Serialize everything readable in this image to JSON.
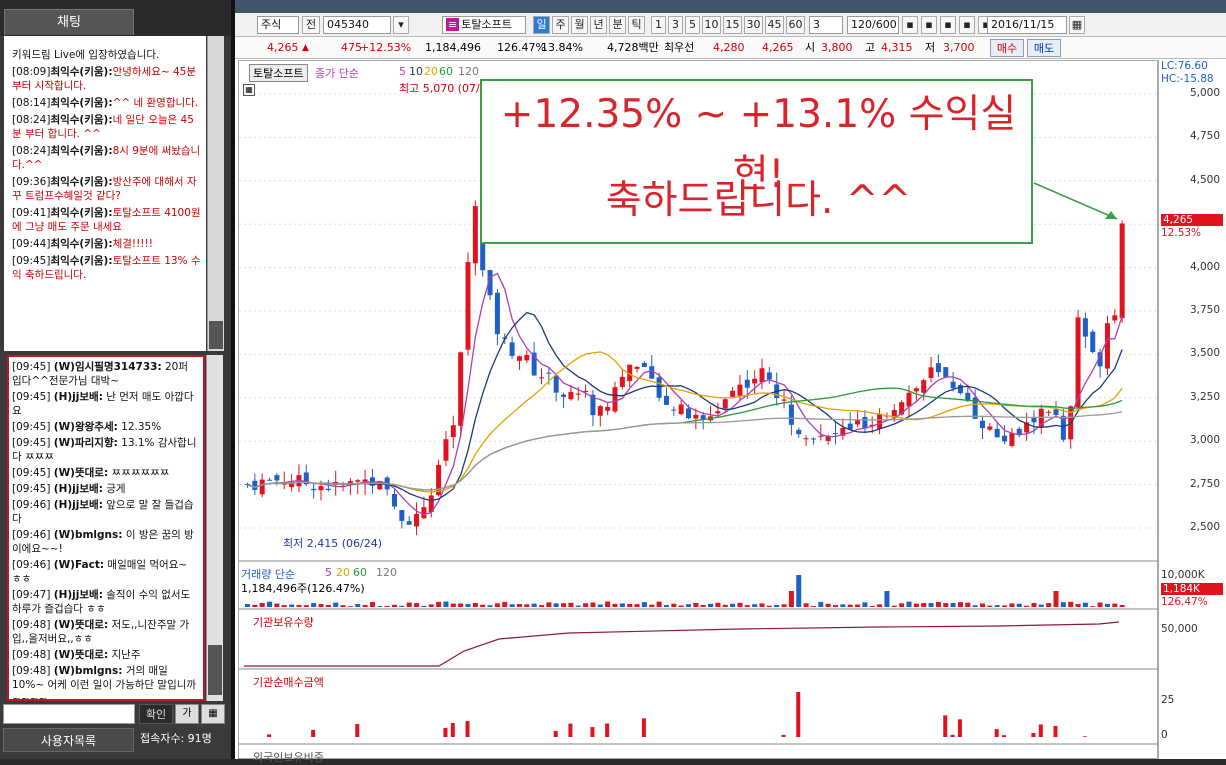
{
  "chat": {
    "tab": "채팅",
    "messages": [
      {
        "time": "",
        "name": "",
        "text": "키워드림 Live에 입장하였습니다."
      },
      {
        "time": "[08:09]",
        "name": "최익수(키움):",
        "text": "안녕하세요~ 45분부터 시작합니다."
      },
      {
        "time": "[08:14]",
        "name": "최익수(키움):",
        "text": "^^ 네 환영합니다."
      },
      {
        "time": "[08:24]",
        "name": "최익수(키움):",
        "text": "네 일단 오늘은 45분 부터 합니다. ^^"
      },
      {
        "time": "[08:24]",
        "name": "최익수(키움):",
        "text": "8시 9분에 써놨습니다.^^"
      },
      {
        "time": "[09:36]",
        "name": "최익수(키움):",
        "text": "방산주에 대해서 자꾸 트럼프수혜일것 같다?"
      },
      {
        "time": "[09:41]",
        "name": "최익수(키움):",
        "text": "토탈소프트 4100원에 그냥 매도 주문 내세요"
      },
      {
        "time": "[09:44]",
        "name": "최익수(키움):",
        "text": "체결!!!!!"
      },
      {
        "time": "[09:45]",
        "name": "최익수(키움):",
        "text": "토탈소프트 13% 수익 축하드립니다."
      }
    ],
    "public": [
      {
        "time": "[09:45]",
        "name": "(W)임시필명314733:",
        "text": "20퍼 입다^^전문가님 대박~"
      },
      {
        "time": "[09:45]",
        "name": "(H)jj보배:",
        "text": "난 먼저 매도 아깝다요"
      },
      {
        "time": "[09:45]",
        "name": "(W)왕왕추세:",
        "text": "12.35%"
      },
      {
        "time": "[09:45]",
        "name": "(W)파리지향:",
        "text": "13.1% 감사합니다 ㅉㅉㅉ"
      },
      {
        "time": "[09:45]",
        "name": "(W)뜻대로:",
        "text": "ㅉㅉㅉㅉㅉㅉ"
      },
      {
        "time": "[09:45]",
        "name": "(H)jj보배:",
        "text": "긍게"
      },
      {
        "time": "[09:46]",
        "name": "(H)jj보배:",
        "text": "앞으로 말 잘 들겁습다"
      },
      {
        "time": "[09:46]",
        "name": "(W)bmlgns:",
        "text": "이 방은 꿈의 방이에요~~!"
      },
      {
        "time": "[09:46]",
        "name": "(W)Fact:",
        "text": "매일매일 먹어요~ ㅎㅎ"
      },
      {
        "time": "[09:47]",
        "name": "(H)jj보배:",
        "text": "솔직이 수익 없서도 하루가 즐겁습다 ㅎㅎ"
      },
      {
        "time": "[09:48]",
        "name": "(W)뜻대로:",
        "text": "저도,,니잔주말 가입,,올저버요,,ㅎㅎ"
      },
      {
        "time": "[09:48]",
        "name": "(W)뜻대로:",
        "text": "지난주"
      },
      {
        "time": "[09:48]",
        "name": "(W)bmlgns:",
        "text": "거의 매일 10%~ 어케 이런 일이 가능하단 말입니까~~~~"
      },
      {
        "time": "[09:48]",
        "name": "(W)뜻대로:",
        "text": "넵"
      }
    ],
    "confirm": "확인",
    "ga": "가",
    "userlist": "사용자목록",
    "usercount": "접속자수: 91명"
  },
  "toolbar": {
    "type": "주식",
    "prev": "전",
    "code": "045340",
    "name": "토탈소프트",
    "periods": [
      "일",
      "주",
      "월",
      "년",
      "분",
      "틱"
    ],
    "nums": [
      "1",
      "3",
      "5",
      "10",
      "15",
      "30",
      "45",
      "60"
    ],
    "sel": "3",
    "count": "120/600",
    "date": "2016/11/15"
  },
  "quote": {
    "price": "4,265",
    "change": "475",
    "rate": "+12.53%",
    "volume": "1,184,496",
    "vrate": "126.47%",
    "turn": "13.84%",
    "amount": "4,728백만",
    "pri": "최우선",
    "ask": "4,280",
    "bid": "4,265",
    "open_l": "시",
    "open": "3,800",
    "high_l": "고",
    "high": "4,315",
    "low_l": "저",
    "low": "3,700",
    "sell": "매수",
    "buy": "매도"
  },
  "chart": {
    "name": "토탈소프트",
    "ma_label": "종가 단순",
    "ma": [
      "5",
      "10",
      "20",
      "60",
      "120"
    ],
    "high_label": "최고 5,070 (07/18)",
    "low_label": "최저 2,415 (06/24)",
    "lc": "LC:76.60",
    "hc": "HC:-15.88",
    "yticks": [
      "5,000",
      "4,750",
      "4,500",
      "4,250",
      "4,000",
      "3,750",
      "3,500",
      "3,250",
      "3,000",
      "2,750",
      "2,500"
    ],
    "last": "4,265",
    "lastpct": "12.53%",
    "annot1": "+12.35% ~ +13.1% 수익실현!",
    "annot2": "축하드립니다. ^^"
  },
  "vol": {
    "label": "거래량 단순",
    "ma": [
      "5",
      "20",
      "60",
      "120"
    ],
    "value": "1,184,496주(126.47%)",
    "tick": "10,000K",
    "last": "1,184K",
    "lastpct": "126.47%"
  },
  "inst": {
    "label": "기관보유수량",
    "tick": "50,000"
  },
  "net": {
    "label": "기관순매수금액",
    "ticks": [
      "25",
      "0"
    ]
  },
  "foreign": {
    "label": "외국인보유비중"
  },
  "colors": {
    "up": "#e0141e",
    "down": "#1f5fc8",
    "ma5": "#b03fb0",
    "ma10": "#1d3a7a",
    "ma20": "#e0a400",
    "ma60": "#2a9a3a",
    "ma120": "#999999"
  }
}
